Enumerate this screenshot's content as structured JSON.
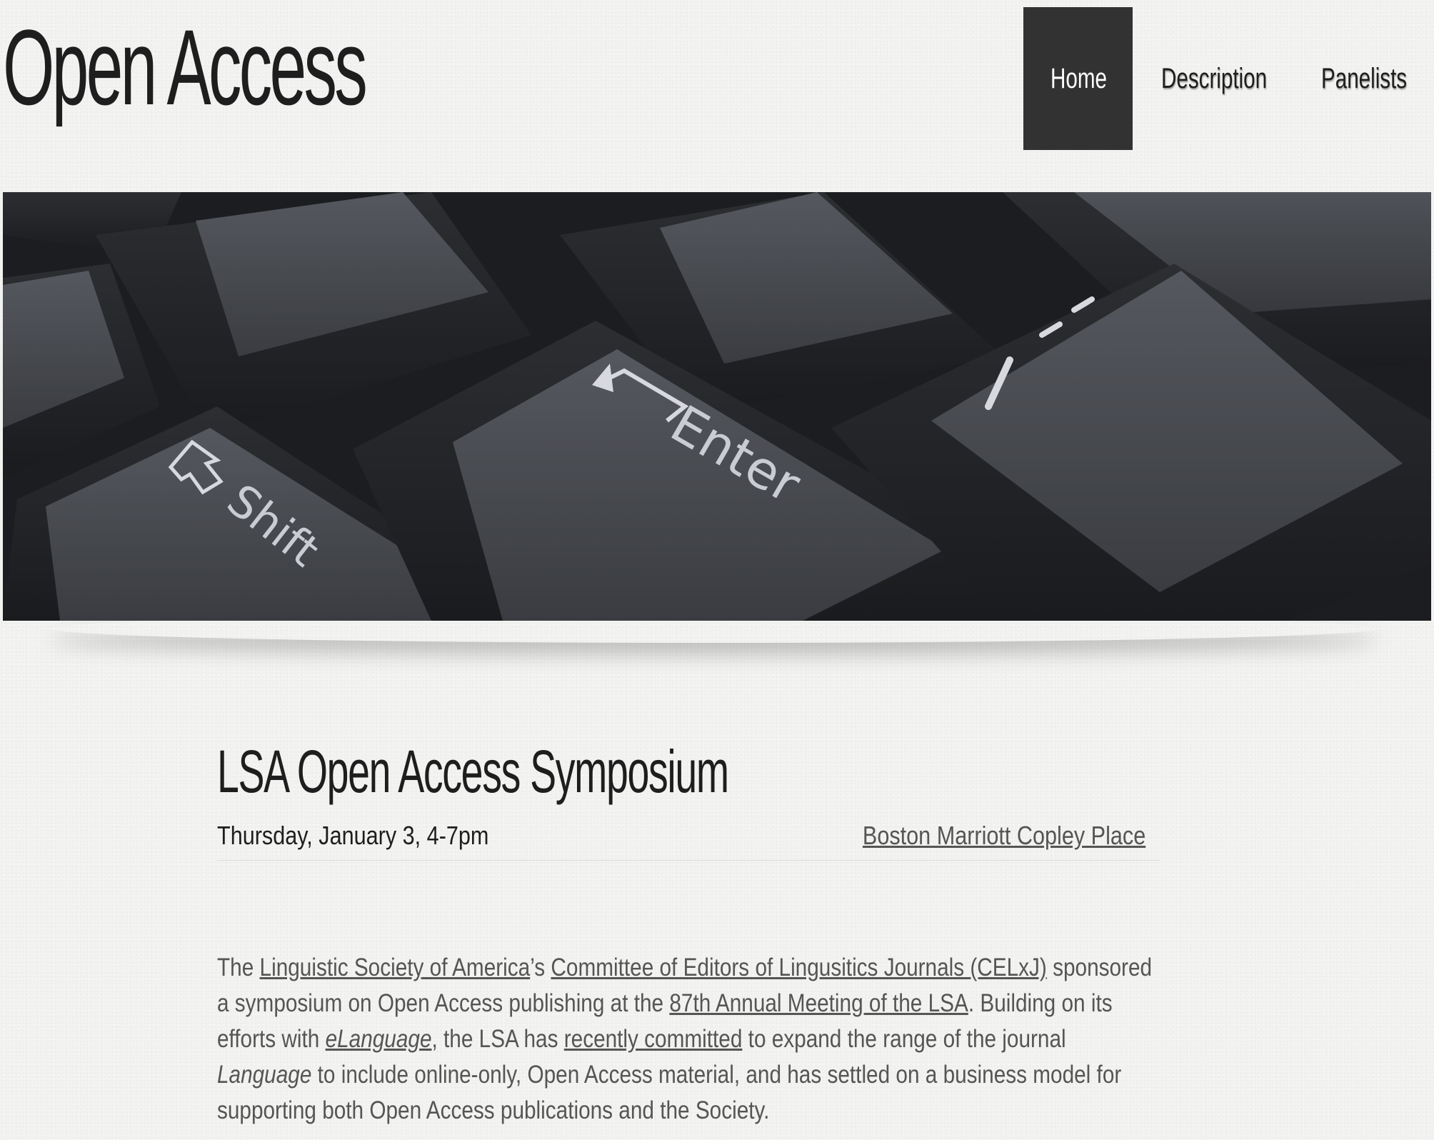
{
  "site": {
    "title": "Open Access"
  },
  "nav": {
    "items": [
      {
        "label": "Home",
        "active": true
      },
      {
        "label": "Description",
        "active": false
      },
      {
        "label": "Panelists",
        "active": false
      }
    ]
  },
  "hero": {
    "keys": {
      "shift": "Shift",
      "enter": "Enter"
    }
  },
  "main": {
    "heading": "LSA Open Access Symposium",
    "date": "Thursday, January 3, 4-7pm",
    "venue": "Boston Marriott Copley Place",
    "intro": {
      "t1": "The ",
      "l1": "Linguistic Society of America",
      "t2": "’s ",
      "l2": "Committee of Editors of Lingusitics Journals (CELxJ)",
      "t3": " sponsored a symposium on Open Access publishing at the ",
      "l3": "87th Annual Meeting of the LSA",
      "t4": ". Building on its efforts with ",
      "l4": "eLanguage",
      "t5": ", the LSA has ",
      "l5": "recently committed",
      "t6": " to expand the range of the journal ",
      "em1": "Language",
      "t7": " to include online-only, Open Access material, and has settled on a business model for supporting both Open Access publications and the Society."
    }
  },
  "colors": {
    "background": "#f2f2f1",
    "nav_active_bg": "#323232",
    "text_dark": "#1e1e1e",
    "text_body": "#555555"
  }
}
